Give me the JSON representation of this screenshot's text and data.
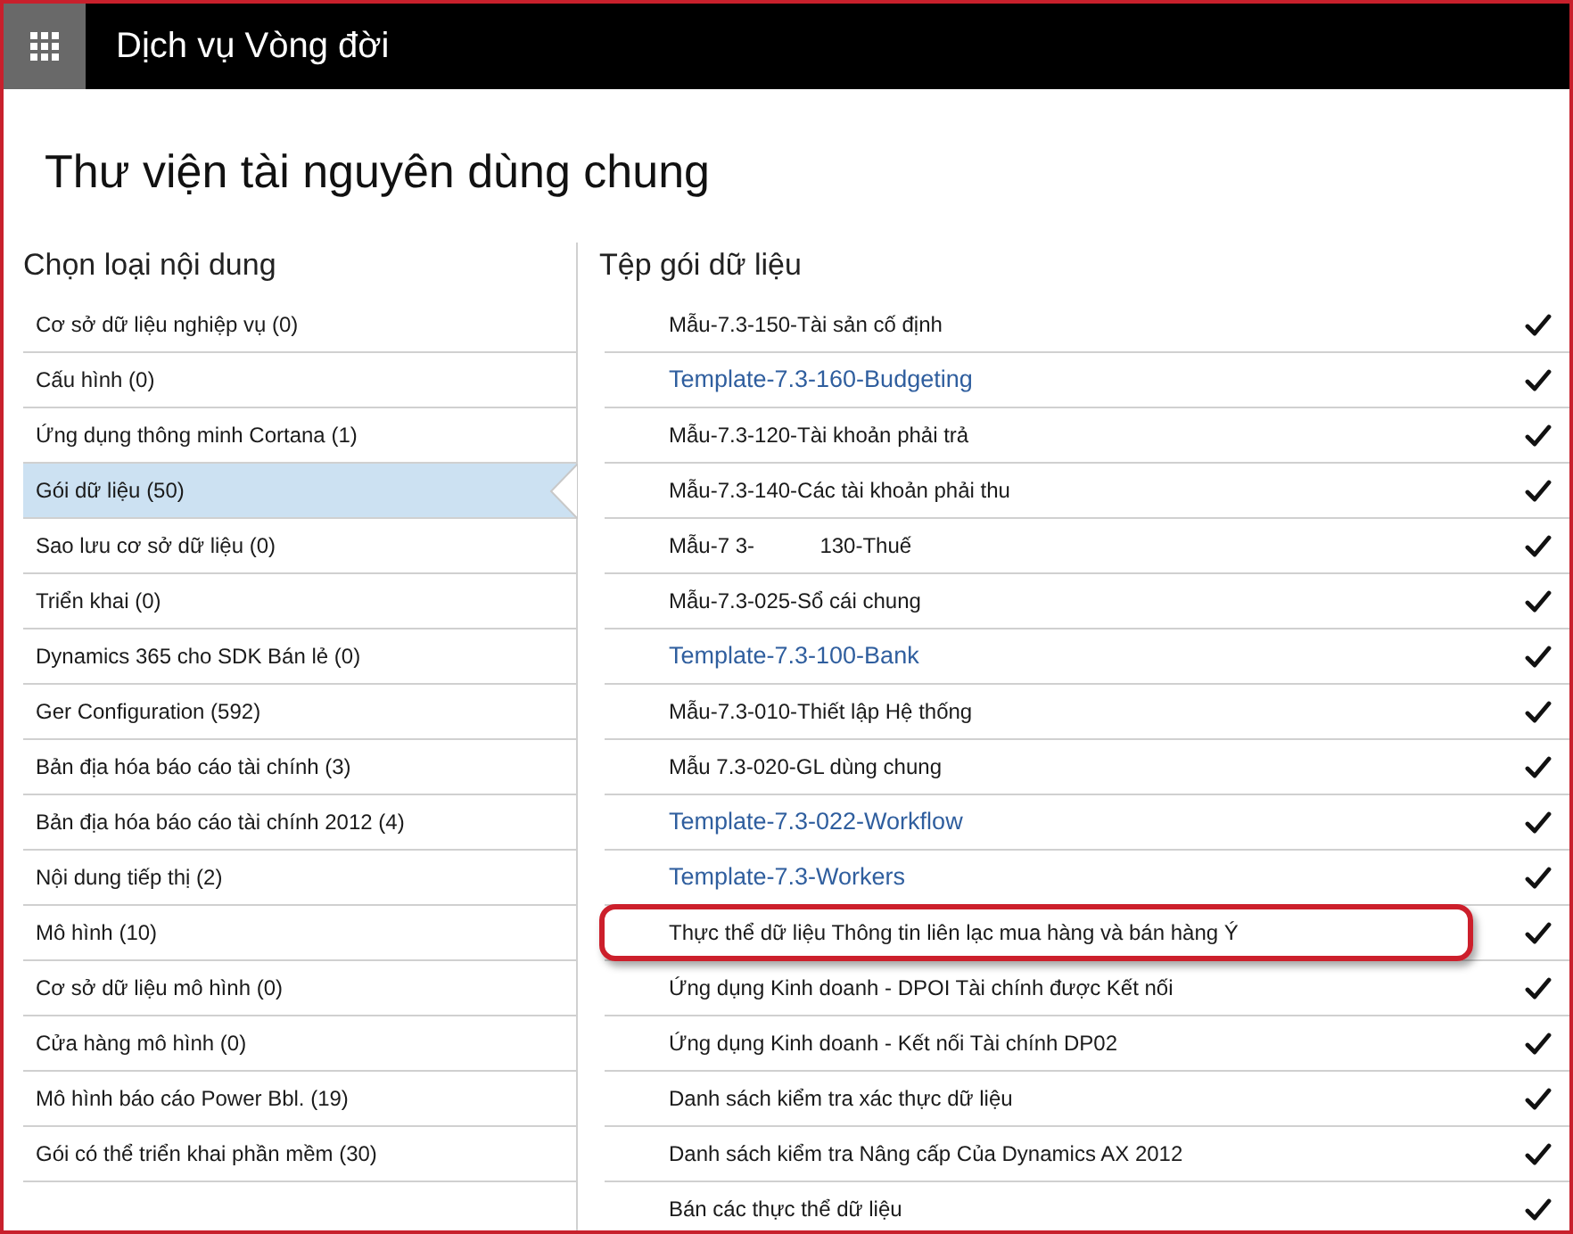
{
  "app_bar": {
    "title": "Dịch vụ Vòng đời"
  },
  "page": {
    "title": "Thư viện tài nguyên dùng chung"
  },
  "categories": {
    "heading": "Chọn loại nội dung",
    "items": [
      {
        "label": "Cơ sở dữ liệu nghiệp vụ (0)",
        "selected": false
      },
      {
        "label": "Cấu hình (0)",
        "selected": false
      },
      {
        "label": "Ứng dụng thông minh Cortana (1)",
        "selected": false
      },
      {
        "label": "Gói dữ liệu (50)",
        "selected": true
      },
      {
        "label": "Sao lưu cơ sở dữ liệu (0)",
        "selected": false
      },
      {
        "label": "Triển khai (0)",
        "selected": false
      },
      {
        "label": "Dynamics 365 cho SDK Bán lẻ (0)",
        "selected": false
      },
      {
        "label": "Ger Configuration (592)",
        "selected": false
      },
      {
        "label": "Bản địa hóa báo cáo tài chính (3)",
        "selected": false
      },
      {
        "label": "Bản địa hóa báo cáo tài chính 2012 (4)",
        "selected": false
      },
      {
        "label": "Nội dung tiếp thị (2)",
        "selected": false
      },
      {
        "label": "Mô hình (10)",
        "selected": false
      },
      {
        "label": "Cơ sở dữ liệu mô hình (0)",
        "selected": false
      },
      {
        "label": "Cửa hàng mô hình (0)",
        "selected": false
      },
      {
        "label": "Mô hình báo cáo Power Bbl. (19)",
        "selected": false
      },
      {
        "label": "Gói có thể triển khai phần mềm (30)",
        "selected": false
      }
    ]
  },
  "files": {
    "heading": "Tệp gói dữ liệu",
    "items": [
      {
        "name": "Mẫu-7.3-150-Tài sản cố định",
        "kind": "plain",
        "checked": true,
        "highlighted": false
      },
      {
        "name": "Template-7.3-160-Budgeting",
        "kind": "link",
        "checked": true,
        "highlighted": false
      },
      {
        "name": "Mẫu-7.3-120-Tài khoản phải trả",
        "kind": "plain",
        "checked": true,
        "highlighted": false
      },
      {
        "name": "Mẫu-7.3-140-Các tài khoản phải thu",
        "kind": "plain",
        "checked": true,
        "highlighted": false
      },
      {
        "name": "Mẫu-7 3-           130-Thuế",
        "kind": "plain",
        "checked": true,
        "highlighted": false
      },
      {
        "name": "Mẫu-7.3-025-Sổ cái chung",
        "kind": "plain",
        "checked": true,
        "highlighted": false
      },
      {
        "name": "Template-7.3-100-Bank",
        "kind": "link",
        "checked": true,
        "highlighted": false
      },
      {
        "name": "Mẫu-7.3-010-Thiết lập Hệ thống",
        "kind": "plain",
        "checked": true,
        "highlighted": false
      },
      {
        "name": "Mẫu 7.3-020-GL dùng chung",
        "kind": "plain",
        "checked": true,
        "highlighted": false
      },
      {
        "name": "Template-7.3-022-Workflow",
        "kind": "link",
        "checked": true,
        "highlighted": false
      },
      {
        "name": "Template-7.3-Workers",
        "kind": "link",
        "checked": true,
        "highlighted": false
      },
      {
        "name": "Thực thể dữ liệu Thông tin liên lạc mua hàng và bán hàng Ý",
        "kind": "plain",
        "checked": true,
        "highlighted": true
      },
      {
        "name": "Ứng dụng Kinh doanh - DPOI Tài chính được Kết nối",
        "kind": "plain",
        "checked": true,
        "highlighted": false
      },
      {
        "name": "Ứng dụng Kinh doanh - Kết nối Tài chính DP02",
        "kind": "plain",
        "checked": true,
        "highlighted": false
      },
      {
        "name": "Danh sách kiểm tra xác thực dữ liệu",
        "kind": "plain",
        "checked": true,
        "highlighted": false
      },
      {
        "name": "Danh sách kiểm tra Nâng cấp Của Dynamics AX 2012",
        "kind": "plain",
        "checked": true,
        "highlighted": false
      },
      {
        "name": "Bán các thực thể dữ liệu",
        "kind": "plain",
        "checked": true,
        "highlighted": false
      }
    ]
  }
}
